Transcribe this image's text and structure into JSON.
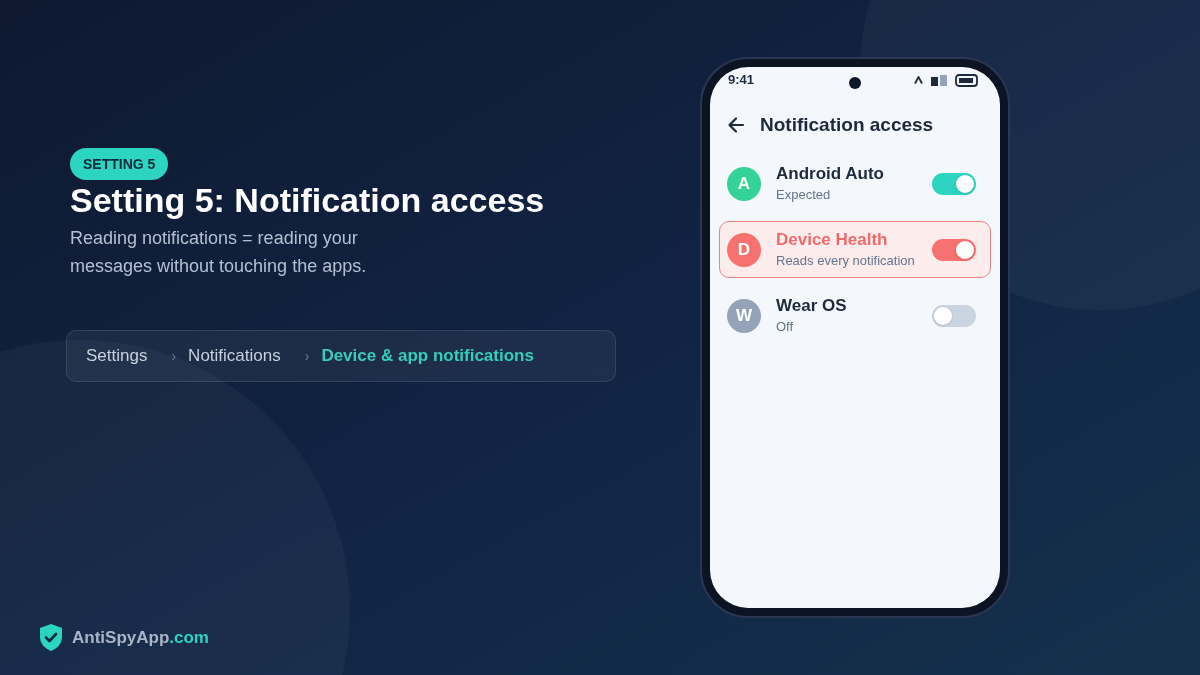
{
  "badge": "SETTING 5",
  "title": "Setting 5: Notification access",
  "subtitle": "Reading notifications = reading your messages without touching the apps.",
  "breadcrumb": [
    {
      "label": "Settings",
      "selected": false
    },
    {
      "separator": "›",
      "label": "Notifications",
      "selected": false
    },
    {
      "separator": "›",
      "label": "Device & app notifications",
      "selected": true
    }
  ],
  "phone": {
    "status_bar": {
      "time": "9:41"
    },
    "header": {
      "title": "Notification access"
    },
    "apps": [
      {
        "initial": "A",
        "name": "Android Auto",
        "status": "Expected",
        "color": "#34d399",
        "on": true,
        "flagged": false
      },
      {
        "initial": "D",
        "name": "Device Health",
        "status": "Reads every notification",
        "color": "#f87171",
        "on": true,
        "flagged": true
      },
      {
        "initial": "W",
        "name": "Wear OS",
        "status": "Off",
        "color": "#94a3b8",
        "on": false,
        "flagged": false
      }
    ]
  },
  "footer": {
    "brand": "AntiSpyApp",
    "domain": ".com"
  }
}
